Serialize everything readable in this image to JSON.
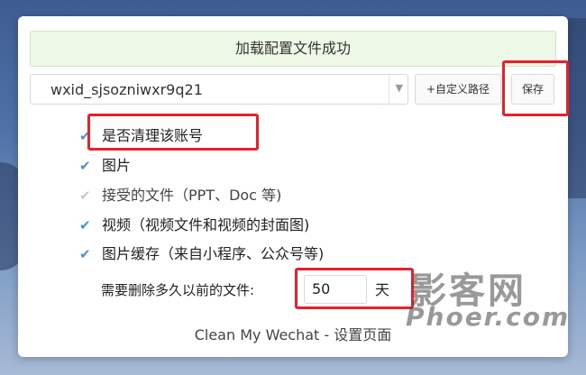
{
  "banner": "加载配置文件成功",
  "account_select": {
    "value": "wxid_sjsozniwxr9q21"
  },
  "buttons": {
    "custom_path": "+自定义路径",
    "save": "保存"
  },
  "options": [
    {
      "label": "是否清理该账号",
      "checked": true
    },
    {
      "label": "图片",
      "checked": true
    },
    {
      "label": "接受的文件（PPT、Doc 等)",
      "checked": false
    },
    {
      "label": "视频（视频文件和视频的封面图)",
      "checked": true
    },
    {
      "label": "图片缓存（来自小程序、公众号等)",
      "checked": true
    }
  ],
  "days": {
    "label": "需要删除多久以前的文件:",
    "value": "50",
    "unit": "天"
  },
  "footer": "Clean My Wechat - 设置页面",
  "watermark": {
    "main": "影客网",
    "sub": "Phoer.com"
  },
  "colors": {
    "check": "#4a90d9",
    "highlight": "#e8202a",
    "banner_bg": "#eef8e6"
  }
}
